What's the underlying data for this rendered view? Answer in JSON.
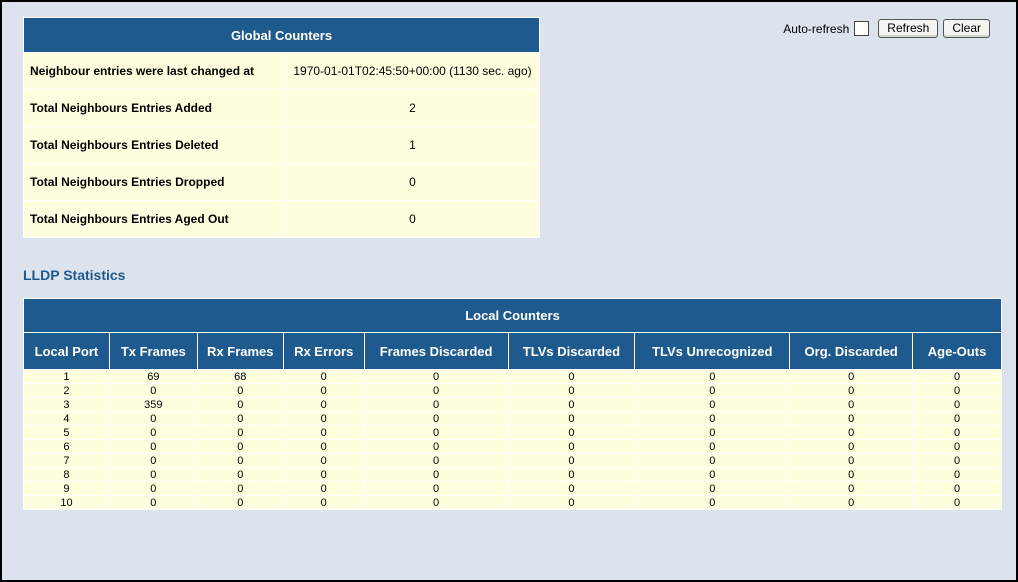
{
  "global": {
    "title": "Global Counters",
    "rows": [
      {
        "label": "Neighbour entries were last changed at",
        "value": "1970-01-01T02:45:50+00:00 (1130 sec. ago)"
      },
      {
        "label": "Total Neighbours Entries Added",
        "value": "2"
      },
      {
        "label": "Total Neighbours Entries Deleted",
        "value": "1"
      },
      {
        "label": "Total Neighbours Entries Dropped",
        "value": "0"
      },
      {
        "label": "Total Neighbours Entries Aged Out",
        "value": "0"
      }
    ]
  },
  "controls": {
    "auto_refresh_label": "Auto-refresh",
    "auto_refresh_checked": false,
    "refresh_label": "Refresh",
    "clear_label": "Clear"
  },
  "lldp": {
    "heading": "LLDP Statistics",
    "table_title": "Local Counters",
    "columns": [
      "Local Port",
      "Tx Frames",
      "Rx Frames",
      "Rx Errors",
      "Frames Discarded",
      "TLVs Discarded",
      "TLVs Unrecognized",
      "Org. Discarded",
      "Age-Outs"
    ],
    "rows": [
      [
        "1",
        "69",
        "68",
        "0",
        "0",
        "0",
        "0",
        "0",
        "0"
      ],
      [
        "2",
        "0",
        "0",
        "0",
        "0",
        "0",
        "0",
        "0",
        "0"
      ],
      [
        "3",
        "359",
        "0",
        "0",
        "0",
        "0",
        "0",
        "0",
        "0"
      ],
      [
        "4",
        "0",
        "0",
        "0",
        "0",
        "0",
        "0",
        "0",
        "0"
      ],
      [
        "5",
        "0",
        "0",
        "0",
        "0",
        "0",
        "0",
        "0",
        "0"
      ],
      [
        "6",
        "0",
        "0",
        "0",
        "0",
        "0",
        "0",
        "0",
        "0"
      ],
      [
        "7",
        "0",
        "0",
        "0",
        "0",
        "0",
        "0",
        "0",
        "0"
      ],
      [
        "8",
        "0",
        "0",
        "0",
        "0",
        "0",
        "0",
        "0",
        "0"
      ],
      [
        "9",
        "0",
        "0",
        "0",
        "0",
        "0",
        "0",
        "0",
        "0"
      ],
      [
        "10",
        "0",
        "0",
        "0",
        "0",
        "0",
        "0",
        "0",
        "0"
      ]
    ]
  },
  "colors": {
    "header_bg": "#1f5a8e",
    "cell_bg": "#ffffe0",
    "page_bg": "#dde3ec",
    "heading_text": "#1f5a8e"
  }
}
